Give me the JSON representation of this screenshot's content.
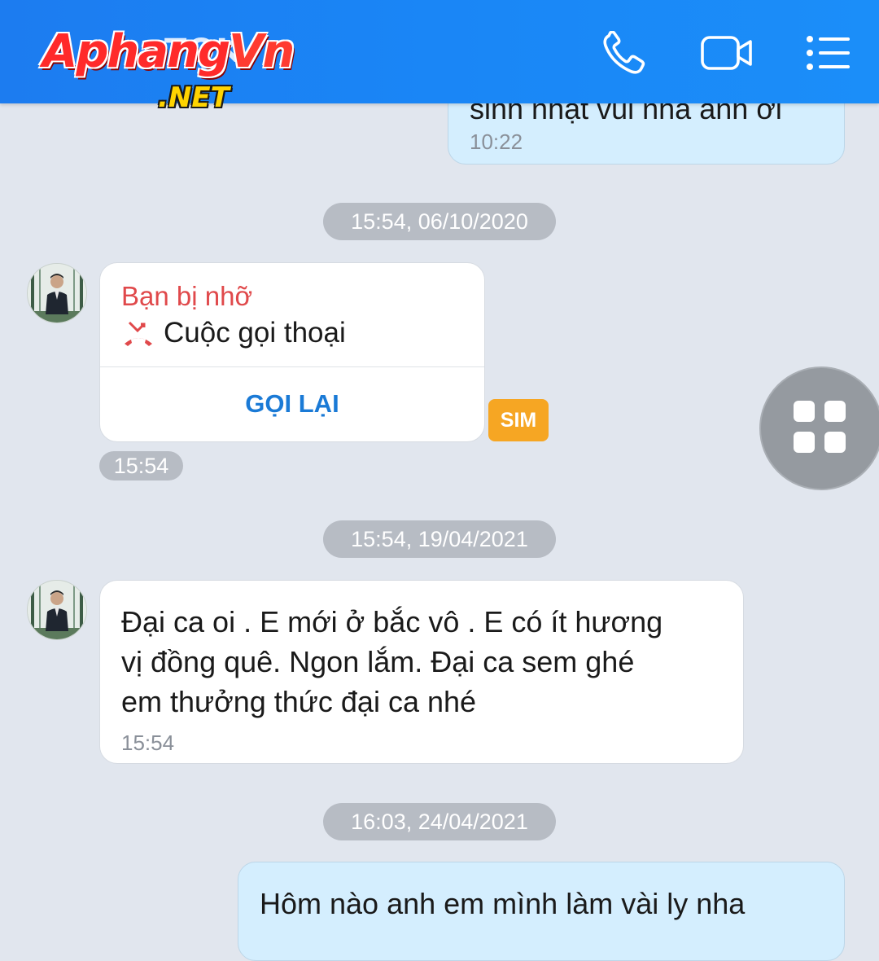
{
  "header": {
    "logo_main": "Aphang",
    "logo_vn": "Vn",
    "logo_sub": ".NET",
    "logo_ghost": "TOK",
    "call_icon": "phone-icon",
    "video_icon": "video-camera-icon",
    "menu_icon": "list-menu-icon"
  },
  "messages": {
    "top_out": {
      "text_cut": "sinh nhật vui nha anh ơi",
      "time": "10:22"
    },
    "sep1": "15:54, 06/10/2020",
    "missed_call": {
      "title": "Bạn bị nhỡ",
      "subtitle": "Cuộc gọi thoại",
      "action": "GỌI LẠI",
      "sim_badge": "SIM",
      "time": "15:54"
    },
    "sep2": "15:54, 19/04/2021",
    "in_msg": {
      "line1": "Đại ca oi . E mới ở bắc vô . E có ít hương",
      "line2": "vị đồng quê. Ngon lắm. Đại ca sem ghé",
      "line3": "em thưởng thức đại ca nhé",
      "time": "15:54"
    },
    "sep3": "16:03, 24/04/2021",
    "bottom_out": {
      "text": "Hôm nào anh em mình làm vài ly nha"
    }
  },
  "floating": {
    "icon": "grid-apps-icon"
  },
  "colors": {
    "header_blue": "#1a86f6",
    "missed_red": "#e0494b",
    "action_blue": "#1a7ad6",
    "sim_orange": "#f6a623",
    "out_bubble": "#d4eefe",
    "background": "#e1e6ee"
  }
}
